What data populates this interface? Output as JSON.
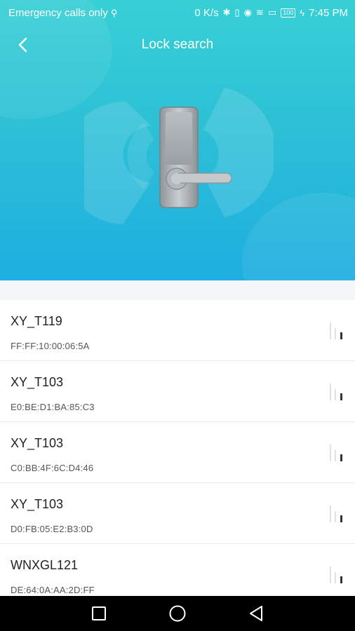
{
  "status_bar": {
    "carrier": "Emergency calls only",
    "speed": "0 K/s",
    "battery": "100",
    "time": "7:45 PM"
  },
  "header": {
    "title": "Lock search"
  },
  "devices": [
    {
      "name": "XY_T119",
      "mac": "FF:FF:10:00:06:5A"
    },
    {
      "name": "XY_T103",
      "mac": "E0:BE:D1:BA:85:C3"
    },
    {
      "name": "XY_T103",
      "mac": "C0:BB:4F:6C:D4:46"
    },
    {
      "name": "XY_T103",
      "mac": "D0:FB:05:E2:B3:0D"
    },
    {
      "name": "WNXGL121",
      "mac": "DE:64:0A:AA:2D:FF"
    }
  ],
  "icons": {
    "back": "chevron-left-icon",
    "signal": "signal-strength-icon",
    "nav_recent": "square-icon",
    "nav_home": "circle-icon",
    "nav_back": "triangle-back-icon"
  },
  "colors": {
    "hero_top": "#37d0d6",
    "hero_bottom": "#1eaee0"
  }
}
